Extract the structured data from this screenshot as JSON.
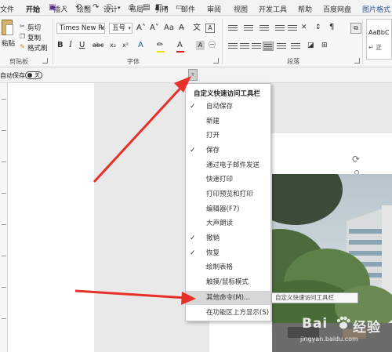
{
  "tabs": [
    "文件",
    "开始",
    "插入",
    "绘图",
    "设计",
    "布局",
    "引用",
    "邮件",
    "审阅",
    "视图",
    "开发工具",
    "帮助",
    "百度网盘",
    "图片格式"
  ],
  "active_tab": "开始",
  "clipboard": {
    "paste": "粘贴",
    "cut": "剪切",
    "copy": "复制",
    "format_painter": "格式刷",
    "group_label": "剪贴板"
  },
  "font": {
    "name": "Times New Ror",
    "size": "五号",
    "group_label": "字体"
  },
  "paragraph": {
    "group_label": "段落"
  },
  "styles": {
    "preview": "AaBbC",
    "normal": "↵ 正"
  },
  "qat": {
    "autosave_label": "自动保存",
    "autosave_state": "关"
  },
  "menu": {
    "title": "自定义快速访问工具栏",
    "items": [
      {
        "label": "自动保存",
        "checked": true
      },
      {
        "label": "新建",
        "checked": false
      },
      {
        "label": "打开",
        "checked": false
      },
      {
        "label": "保存",
        "checked": true
      },
      {
        "label": "通过电子邮件发送",
        "checked": false
      },
      {
        "label": "快速打印",
        "checked": false
      },
      {
        "label": "打印预览和打印",
        "checked": false
      },
      {
        "label": "编辑器(F7)",
        "checked": false
      },
      {
        "label": "大声朗读",
        "checked": false
      },
      {
        "label": "撤销",
        "checked": true
      },
      {
        "label": "恢复",
        "checked": true
      },
      {
        "label": "绘制表格",
        "checked": false
      },
      {
        "label": "触摸/鼠标模式",
        "checked": false
      },
      {
        "label": "其他命令(M)...",
        "checked": false,
        "hover": true
      },
      {
        "label": "在功能区上方显示(S)",
        "checked": false
      }
    ]
  },
  "tooltip": "自定义快速访问工具栏",
  "watermark": {
    "brand": "Bai",
    "suffix": "经验",
    "url": "jingyan.baidu.com"
  },
  "colors": {
    "accent": "#2b579a",
    "arrow": "#e8302a",
    "menu_hover": "#d7d7d7"
  }
}
